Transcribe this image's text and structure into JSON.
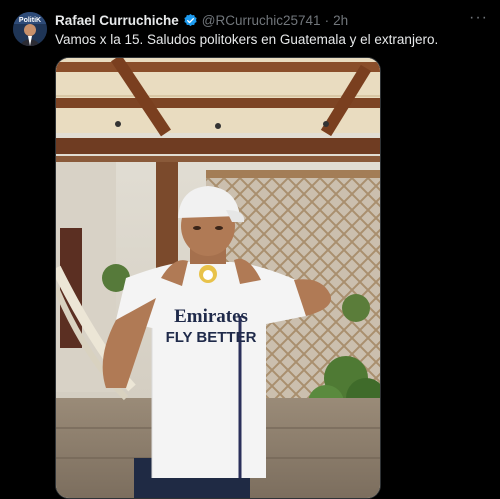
{
  "tweet": {
    "author_name": "Rafael Curruchiche",
    "handle": "@RCurruchic25741",
    "separator": "·",
    "time": "2h",
    "more_label": "···",
    "text": "Vamos x la 15. Saludos politokers en Guatemala y el extranjero.",
    "avatar_text": "PolitiK"
  },
  "media": {
    "shirt_text_line1": "Emirates",
    "shirt_text_line2": "FLY BETTER"
  },
  "colors": {
    "background": "#000000",
    "text_primary": "#e7e9ea",
    "text_secondary": "#71767b",
    "verified_blue": "#1d9bf0"
  },
  "icons": {
    "verified": "verified-badge-icon",
    "more": "more-options-icon"
  }
}
